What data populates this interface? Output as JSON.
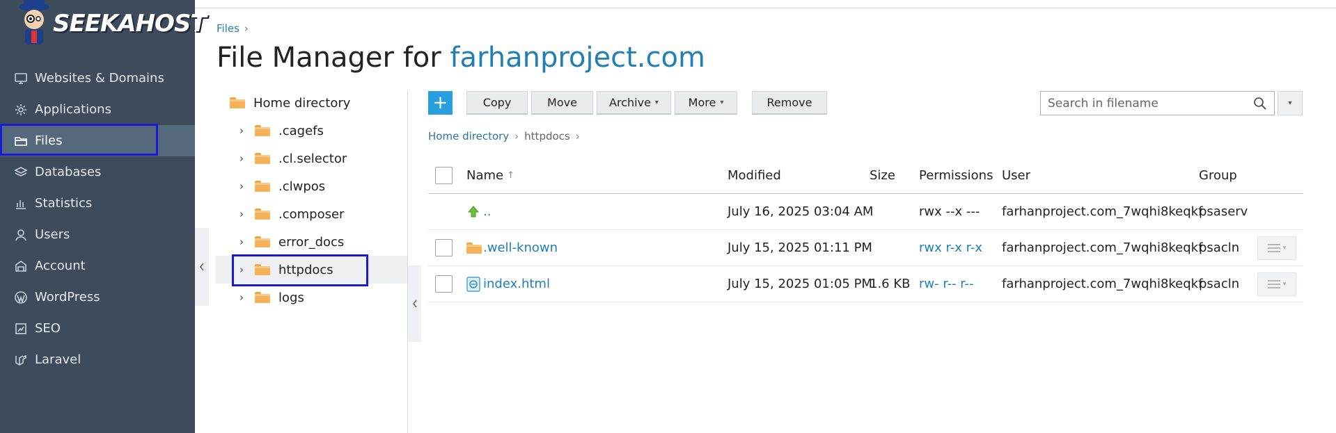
{
  "brand": {
    "name": "SEEKAHOST"
  },
  "sidebar": {
    "items": [
      {
        "label": "Websites & Domains",
        "icon": "monitor-icon",
        "active": false
      },
      {
        "label": "Applications",
        "icon": "gear-icon",
        "active": false
      },
      {
        "label": "Files",
        "icon": "folder-icon",
        "active": true
      },
      {
        "label": "Databases",
        "icon": "database-icon",
        "active": false
      },
      {
        "label": "Statistics",
        "icon": "bar-chart-icon",
        "active": false
      },
      {
        "label": "Users",
        "icon": "user-icon",
        "active": false
      },
      {
        "label": "Account",
        "icon": "account-icon",
        "active": false
      },
      {
        "label": "WordPress",
        "icon": "wordpress-icon",
        "active": false
      },
      {
        "label": "SEO",
        "icon": "seo-icon",
        "active": false
      },
      {
        "label": "Laravel",
        "icon": "laravel-icon",
        "active": false
      }
    ]
  },
  "breadcrumb": {
    "root": "Files",
    "sep": "›"
  },
  "page": {
    "title_prefix": "File Manager for ",
    "title_domain": "farhanproject.com"
  },
  "tree": {
    "root": "Home directory",
    "items": [
      {
        "label": ".cagefs",
        "selected": false
      },
      {
        "label": ".cl.selector",
        "selected": false
      },
      {
        "label": ".clwpos",
        "selected": false
      },
      {
        "label": ".composer",
        "selected": false
      },
      {
        "label": "error_docs",
        "selected": false
      },
      {
        "label": "httpdocs",
        "selected": true
      },
      {
        "label": "logs",
        "selected": false
      }
    ]
  },
  "toolbar": {
    "add_label": "+",
    "copy": "Copy",
    "move": "Move",
    "archive": "Archive",
    "more": "More",
    "remove": "Remove",
    "search_placeholder": "Search in filename"
  },
  "path": {
    "home": "Home directory",
    "current": "httpdocs",
    "sep": "›"
  },
  "table": {
    "headers": {
      "name": "Name",
      "modified": "Modified",
      "size": "Size",
      "permissions": "Permissions",
      "user": "User",
      "group": "Group"
    },
    "sort_indicator": "↑",
    "rows": [
      {
        "name": "..",
        "type": "parent",
        "modified": "July 16, 2025 03:04 AM",
        "size": "",
        "permissions": "rwx --x ---",
        "user": "farhanproject.com_7wqhi8keqkf",
        "group": "psaserv"
      },
      {
        "name": ".well-known",
        "type": "folder",
        "modified": "July 15, 2025 01:11 PM",
        "size": "",
        "permissions": "rwx r-x r-x",
        "user": "farhanproject.com_7wqhi8keqkf",
        "group": "psacln"
      },
      {
        "name": "index.html",
        "type": "file",
        "modified": "July 15, 2025 01:05 PM",
        "size": "1.6 KB",
        "permissions": "rw- r-- r--",
        "user": "farhanproject.com_7wqhi8keqkf",
        "group": "psacln"
      }
    ]
  },
  "colors": {
    "sidebar_bg": "#3e4b5b",
    "accent": "#1f7fb6",
    "add_button": "#2a9fdf",
    "highlight": "#1a1ad6"
  }
}
